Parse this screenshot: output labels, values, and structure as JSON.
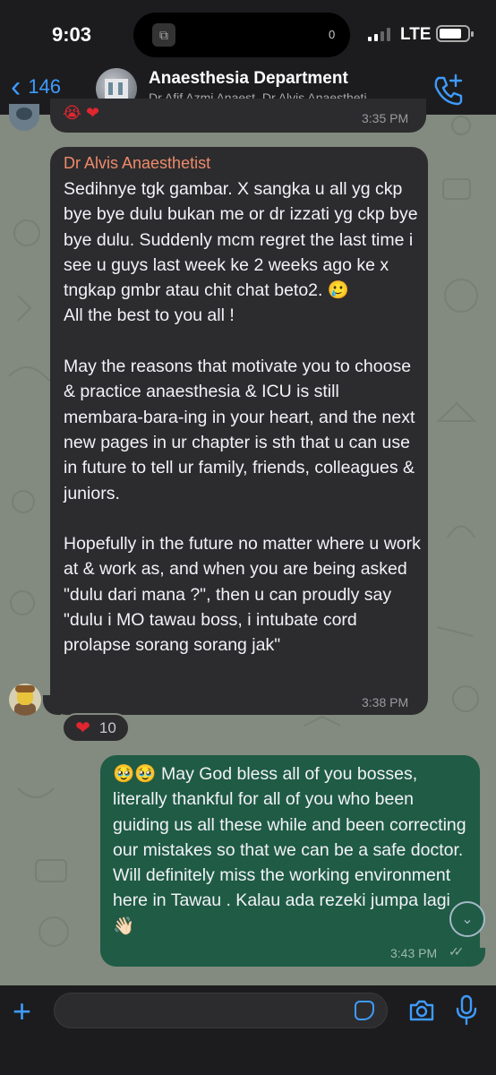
{
  "status_bar": {
    "time": "9:03",
    "notification_count": "0",
    "network": "LTE"
  },
  "header": {
    "back_count": "146",
    "group_name": "Anaesthesia Department",
    "members": "Dr Afif Azmi Anaest, Dr Alvis Anaestheti..."
  },
  "previous_message": {
    "emoji": "😭 ❤",
    "time": "3:35 PM"
  },
  "incoming_message": {
    "sender": "Dr Alvis Anaesthetist",
    "text": "Sedihnye tgk gambar. X sangka u all yg ckp bye bye dulu bukan me or dr izzati yg ckp bye bye dulu. Suddenly mcm regret the last time i see u guys last week ke 2 weeks ago ke x tngkap gmbr atau chit chat beto2. 🥲\nAll the best to you all !\n\nMay the reasons that motivate you to choose & practice anaesthesia & ICU is still membara-bara-ing in your heart, and the next new pages in ur chapter is sth that u can use in future to tell ur family, friends, colleagues & juniors.\n\nHopefully in the future no matter where u work at & work as, and when you are being asked \"dulu dari mana ?\", then u can proudly say \"dulu i MO tawau boss, i intubate cord prolapse sorang sorang jak\"",
    "time": "3:38 PM",
    "reaction_emoji": "❤",
    "reaction_count": "10"
  },
  "outgoing_message": {
    "text": "🥹🥹 May God bless all of you bosses, literally thankful for all of you who been guiding us all these while and been correcting our mistakes so that we can be a safe doctor. Will definitely miss the working environment here in Tawau . Kalau ada rezeki jumpa lagi 👋🏻",
    "time": "3:43 PM",
    "ticks": "✓✓"
  },
  "input": {
    "placeholder": ""
  },
  "icons": {
    "back": "chevron-left-icon",
    "call": "phone-plus-icon",
    "plus": "plus-icon",
    "sticker": "sticker-icon",
    "camera": "camera-icon",
    "mic": "microphone-icon",
    "scroll_down": "chevron-down-icon"
  },
  "colors": {
    "accent": "#3e9bfd",
    "incoming_bubble": "#2c2c2e",
    "outgoing_bubble": "#1f5b45",
    "sender_name": "#ef8a6a",
    "wallpaper": "#838a80"
  }
}
